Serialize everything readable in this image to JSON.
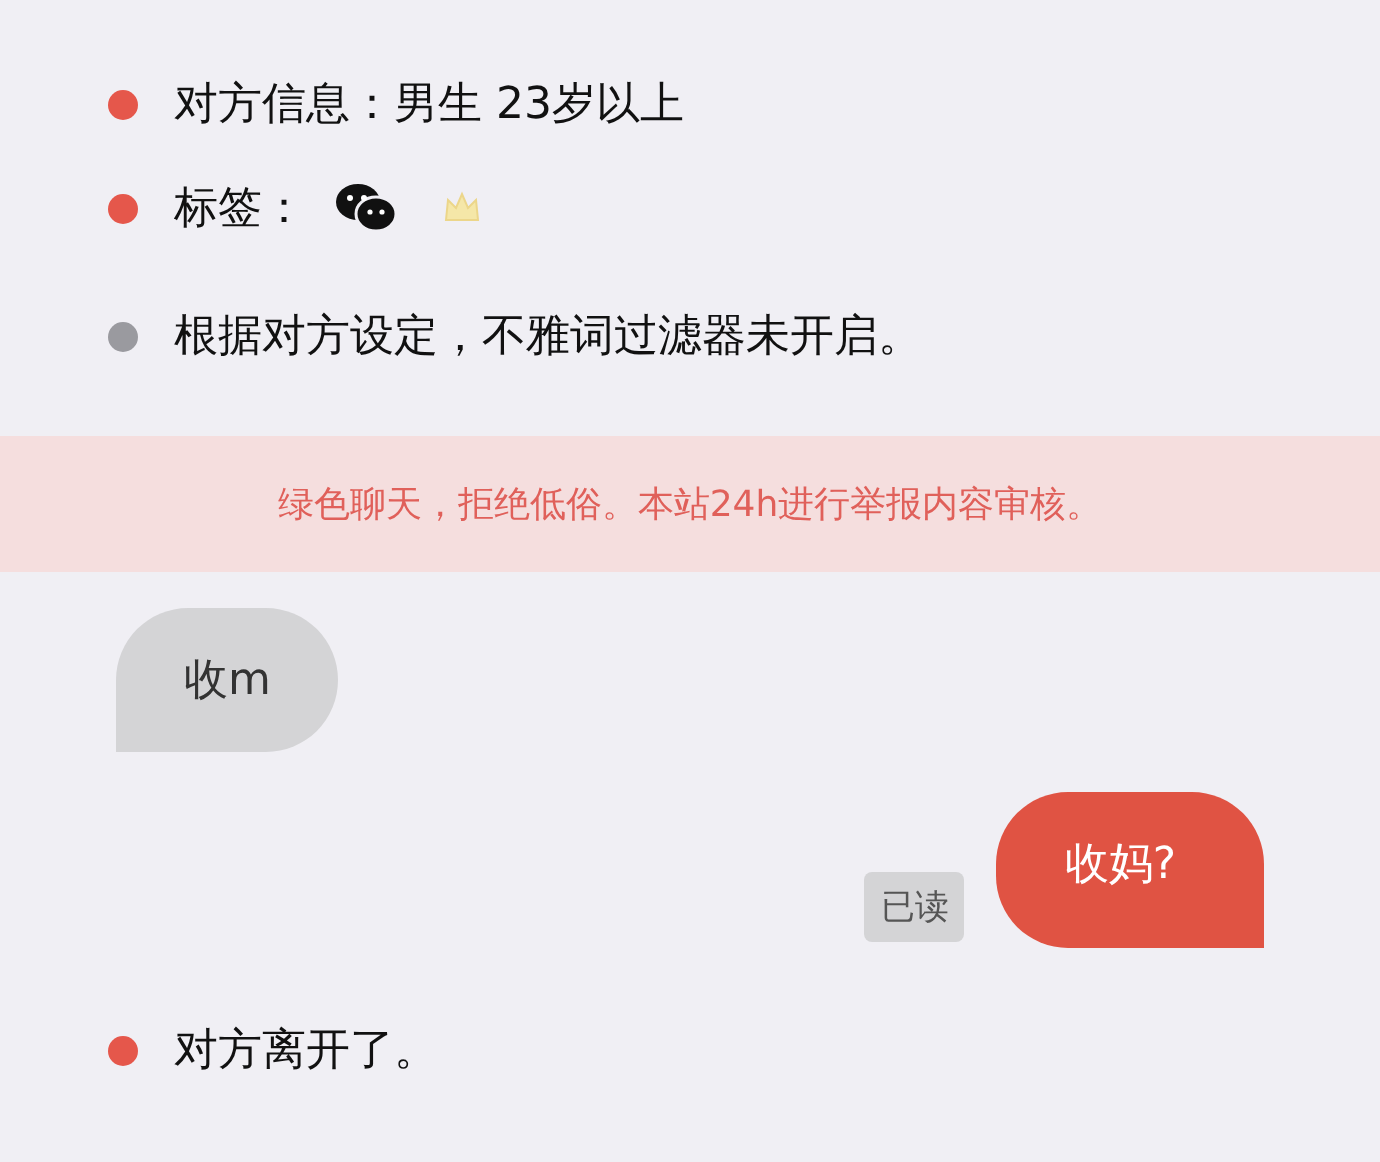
{
  "info": [
    {
      "kind": "text",
      "color": "#e5574b",
      "text": "对方信息：男生 23岁以上"
    },
    {
      "kind": "tags",
      "color": "#e5574b",
      "text": "标签："
    },
    {
      "kind": "text",
      "color": "#9a9a9f",
      "text": "根据对方设定，不雅词过滤器未开启。"
    }
  ],
  "notice": "绿色聊天，拒绝低俗。本站24h进行举报内容审核。",
  "messages": [
    {
      "kind": "incoming",
      "text": "收m"
    },
    {
      "kind": "outgoing",
      "text": "收妈?",
      "status": "已读"
    }
  ],
  "footer": {
    "color": "#e5574b",
    "text": "对方离开了。"
  }
}
